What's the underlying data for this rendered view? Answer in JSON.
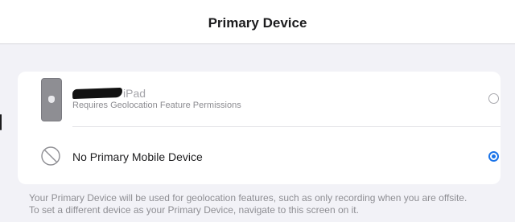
{
  "header": {
    "title": "Primary Device"
  },
  "devices": [
    {
      "name_suffix": "iPad",
      "subtitle": "Requires Geolocation Feature Permissions",
      "selected": false,
      "icon": "phone-icon"
    },
    {
      "name": "No Primary Mobile Device",
      "selected": true,
      "icon": "prohibited-icon"
    }
  ],
  "footer": {
    "line1": "Your Primary Device will be used for geolocation features, such as only recording when you are offsite.",
    "line2": "To set a different device as your Primary Device, navigate to this screen on it."
  },
  "colors": {
    "accent": "#1a73e8",
    "background": "#f2f2f7",
    "card": "#ffffff"
  }
}
